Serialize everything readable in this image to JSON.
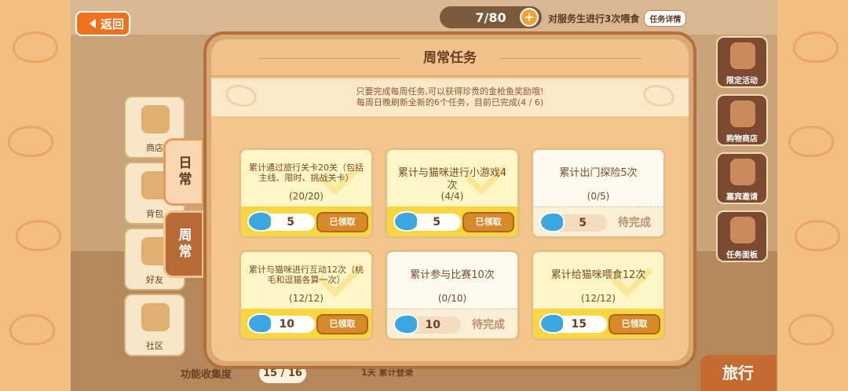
{
  "nav": {
    "back_label": "返回"
  },
  "topbar": {
    "counter": "7/80",
    "task_text": "对服务生进行3次喂食",
    "detail_label": "任务详情"
  },
  "left_menu": [
    {
      "label": "商店"
    },
    {
      "label": "背包"
    },
    {
      "label": "好友"
    },
    {
      "label": "社区"
    }
  ],
  "right_menu": [
    {
      "label": "限定活动"
    },
    {
      "label": "购物商店"
    },
    {
      "label": "嘉宾邀请"
    },
    {
      "label": "任务面板"
    }
  ],
  "tabs": {
    "daily": "日常",
    "weekly": "周常"
  },
  "bottom": {
    "collection_label": "功能收集度",
    "collection_value": "15 / 16",
    "login_label": "1天 累计登录",
    "travel_label": "旅行"
  },
  "dialog": {
    "title": "周常任务",
    "desc_line1": "只要完成每周任务,可以获得珍贵的金枪鱼奖励哦!",
    "desc_line2": "每周日晚刷新全新的6个任务，目前已完成(4 / 6)",
    "tasks": [
      {
        "title": "累计通过旅行关卡20关（包括主线、限时、挑战关卡）",
        "progress": "(20/20)",
        "reward": "5",
        "status": "已领取"
      },
      {
        "title": "累计与猫咪进行小游戏4次",
        "progress": "(4/4)",
        "reward": "5",
        "status": "已领取"
      },
      {
        "title": "累计出门探险5次",
        "progress": "(0/5)",
        "reward": "5",
        "status": "待完成"
      },
      {
        "title": "累计与猫咪进行互动12次（桃毛和逗猫各算一次）",
        "progress": "(12/12)",
        "reward": "10",
        "status": "已领取"
      },
      {
        "title": "累计参与比赛10次",
        "progress": "(0/10)",
        "reward": "10",
        "status": "待完成"
      },
      {
        "title": "累计给猫咪喂食12次",
        "progress": "(12/12)",
        "reward": "15",
        "status": "已领取"
      }
    ]
  }
}
